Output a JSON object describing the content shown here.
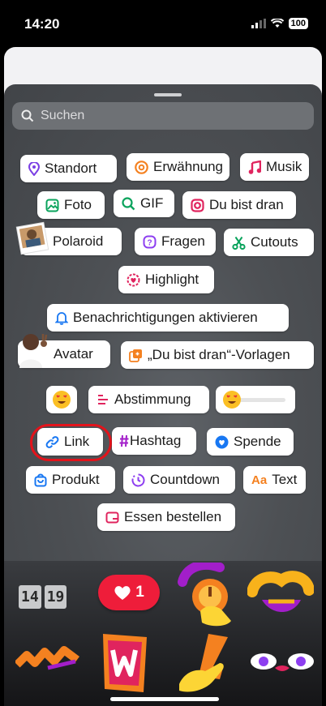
{
  "status": {
    "time": "14:20",
    "battery": "100"
  },
  "search": {
    "placeholder": "Suchen"
  },
  "stickers": {
    "standort": "Standort",
    "erwaehnung": "Erwähnung",
    "musik": "Musik",
    "foto": "Foto",
    "gif": "GIF",
    "du_bist_dran": "Du bist dran",
    "polaroid": "Polaroid",
    "fragen": "Fragen",
    "cutouts": "Cutouts",
    "highlight": "Highlight",
    "benachrichtigungen": "Benachrichtigungen aktivieren",
    "avatar": "Avatar",
    "vorlagen": "„Du bist dran“-Vorlagen",
    "abstimmung": "Abstimmung",
    "link": "Link",
    "hashtag": "Hashtag",
    "spende": "Spende",
    "produkt": "Produkt",
    "countdown": "Countdown",
    "text": "Text",
    "text_icon": "Aa",
    "essen": "Essen bestellen"
  },
  "gallery": {
    "clock_hour": "14",
    "clock_min": "19",
    "like_count": "1"
  },
  "colors": {
    "highlight_ring": "#e3131b",
    "like_red": "#ee1d3a"
  }
}
